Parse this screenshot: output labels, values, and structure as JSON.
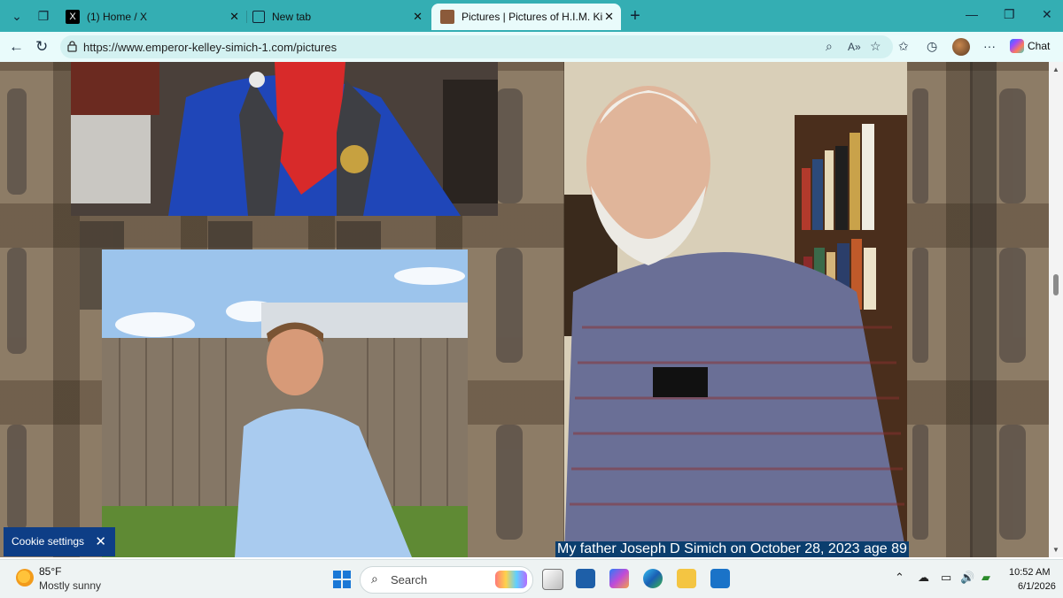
{
  "tabs": [
    {
      "title": "(1) Home / X",
      "active": false
    },
    {
      "title": "New tab",
      "active": false
    },
    {
      "title": "Pictures | Pictures of H.I.M. King Si",
      "active": true
    }
  ],
  "address_bar": {
    "url": "https://www.emperor-kelley-simich-1.com/pictures"
  },
  "toolbar": {
    "chat_label": "Chat"
  },
  "page": {
    "caption": "My father Joseph D Simich on October 28, 2023 age 89",
    "cookie_settings_label": "Cookie settings"
  },
  "taskbar": {
    "weather": {
      "temp": "85°F",
      "desc": "Mostly sunny"
    },
    "search_placeholder": "Search",
    "time": "10:52 AM",
    "date": "6/1/2026"
  },
  "colors": {
    "titlebar": "#34aeb3",
    "navbar": "#e9fbfb",
    "caption_bg": "#0b3e6e",
    "cookie_bg": "#0e3e86"
  }
}
